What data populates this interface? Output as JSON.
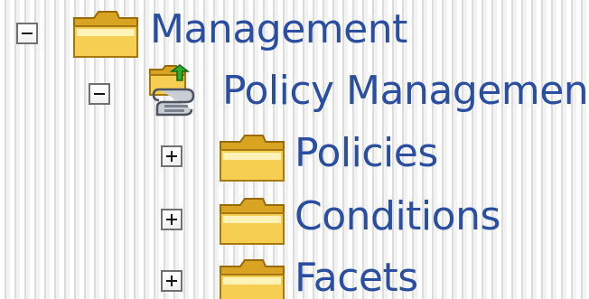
{
  "tree": {
    "management": {
      "label": "Management",
      "expanded": true,
      "icon": "folder-icon"
    },
    "policy_management": {
      "label": "Policy Management",
      "expanded": true,
      "icon": "policy-management-icon"
    },
    "children": [
      {
        "label": "Policies",
        "expanded": false,
        "icon": "folder-icon"
      },
      {
        "label": "Conditions",
        "expanded": false,
        "icon": "folder-icon"
      },
      {
        "label": "Facets",
        "expanded": false,
        "icon": "folder-icon"
      }
    ]
  },
  "colors": {
    "label_text": "#2a4fa0",
    "folder_front": "#f6cf52",
    "folder_back": "#d9a422",
    "folder_highlight": "#fff3b8",
    "expander_border": "#707070"
  }
}
